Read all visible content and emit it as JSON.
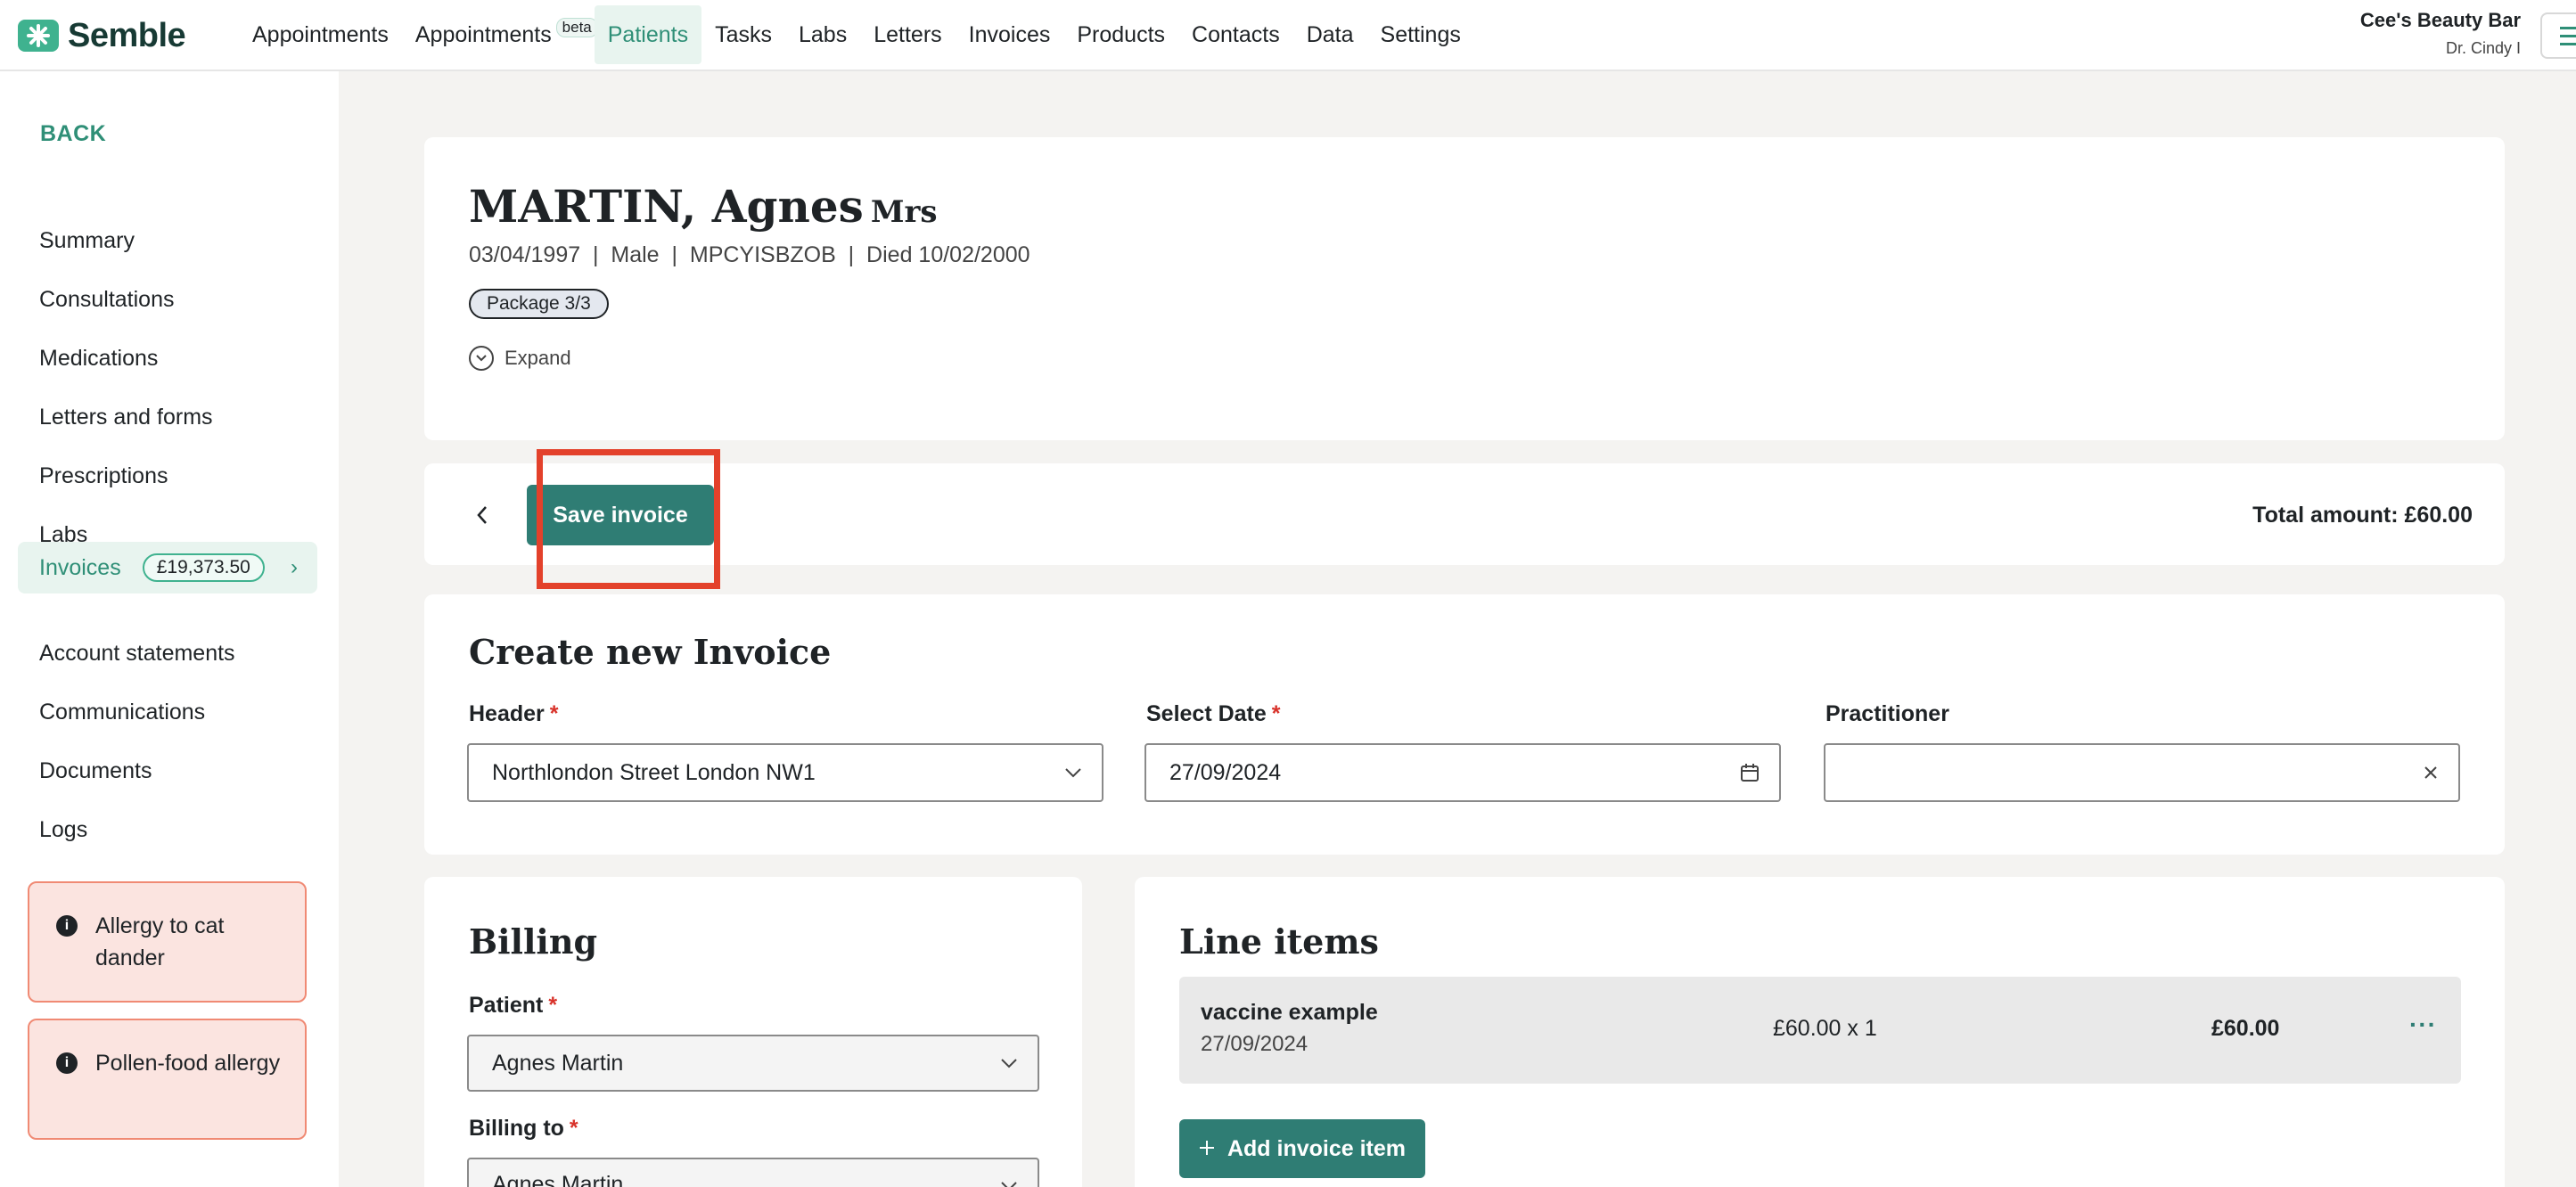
{
  "app": {
    "name": "Semble"
  },
  "nav": {
    "items": [
      {
        "label": "Appointments"
      },
      {
        "label": "Appointments",
        "badge": "beta"
      },
      {
        "label": "Patients",
        "active": true
      },
      {
        "label": "Tasks"
      },
      {
        "label": "Labs"
      },
      {
        "label": "Letters"
      },
      {
        "label": "Invoices"
      },
      {
        "label": "Products"
      },
      {
        "label": "Contacts"
      },
      {
        "label": "Data"
      },
      {
        "label": "Settings"
      }
    ]
  },
  "account": {
    "business": "Cee's Beauty Bar",
    "user": "Dr. Cindy I"
  },
  "sidebar": {
    "back_label": "BACK",
    "items": [
      {
        "label": "Summary"
      },
      {
        "label": "Consultations"
      },
      {
        "label": "Medications"
      },
      {
        "label": "Letters and forms"
      },
      {
        "label": "Prescriptions"
      },
      {
        "label": "Labs"
      },
      {
        "label": "Invoices",
        "badge": "£19,373.50",
        "active": true
      },
      {
        "label": "Account statements"
      },
      {
        "label": "Communications"
      },
      {
        "label": "Documents"
      },
      {
        "label": "Logs"
      }
    ],
    "alerts": [
      {
        "text": "Allergy to cat dander"
      },
      {
        "text": "Pollen-food allergy"
      }
    ]
  },
  "patient": {
    "name": "MARTIN, Agnes",
    "title": "Mrs",
    "meta": "03/04/1997  |  Male  |  MPCYISBZOB  |  Died 10/02/2000",
    "package_badge": "Package 3/3",
    "expand_label": "Expand"
  },
  "toolbar": {
    "save_label": "Save invoice",
    "total_label": "Total amount: £60.00"
  },
  "invoice_form": {
    "title": "Create new Invoice",
    "header": {
      "label": "Header",
      "required": "*",
      "value": "Northlondon Street London NW1"
    },
    "date": {
      "label": "Select Date",
      "required": "*",
      "value": "27/09/2024"
    },
    "practitioner": {
      "label": "Practitioner",
      "value": ""
    }
  },
  "billing": {
    "title": "Billing",
    "patient": {
      "label": "Patient",
      "required": "*",
      "value": "Agnes Martin"
    },
    "billing_to": {
      "label": "Billing to",
      "required": "*",
      "value": "Agnes Martin"
    }
  },
  "line_items": {
    "title": "Line items",
    "items": [
      {
        "name": "vaccine example",
        "date": "27/09/2024",
        "qty": "£60.00 x 1",
        "amount": "£60.00",
        "more": "···"
      }
    ],
    "add_label": "Add invoice item"
  },
  "colors": {
    "accent": "#2f7d74",
    "brand": "#3fb28f",
    "highlight": "#e3412b",
    "alert_bg": "#fbe4e0",
    "alert_border": "#f08a74"
  }
}
